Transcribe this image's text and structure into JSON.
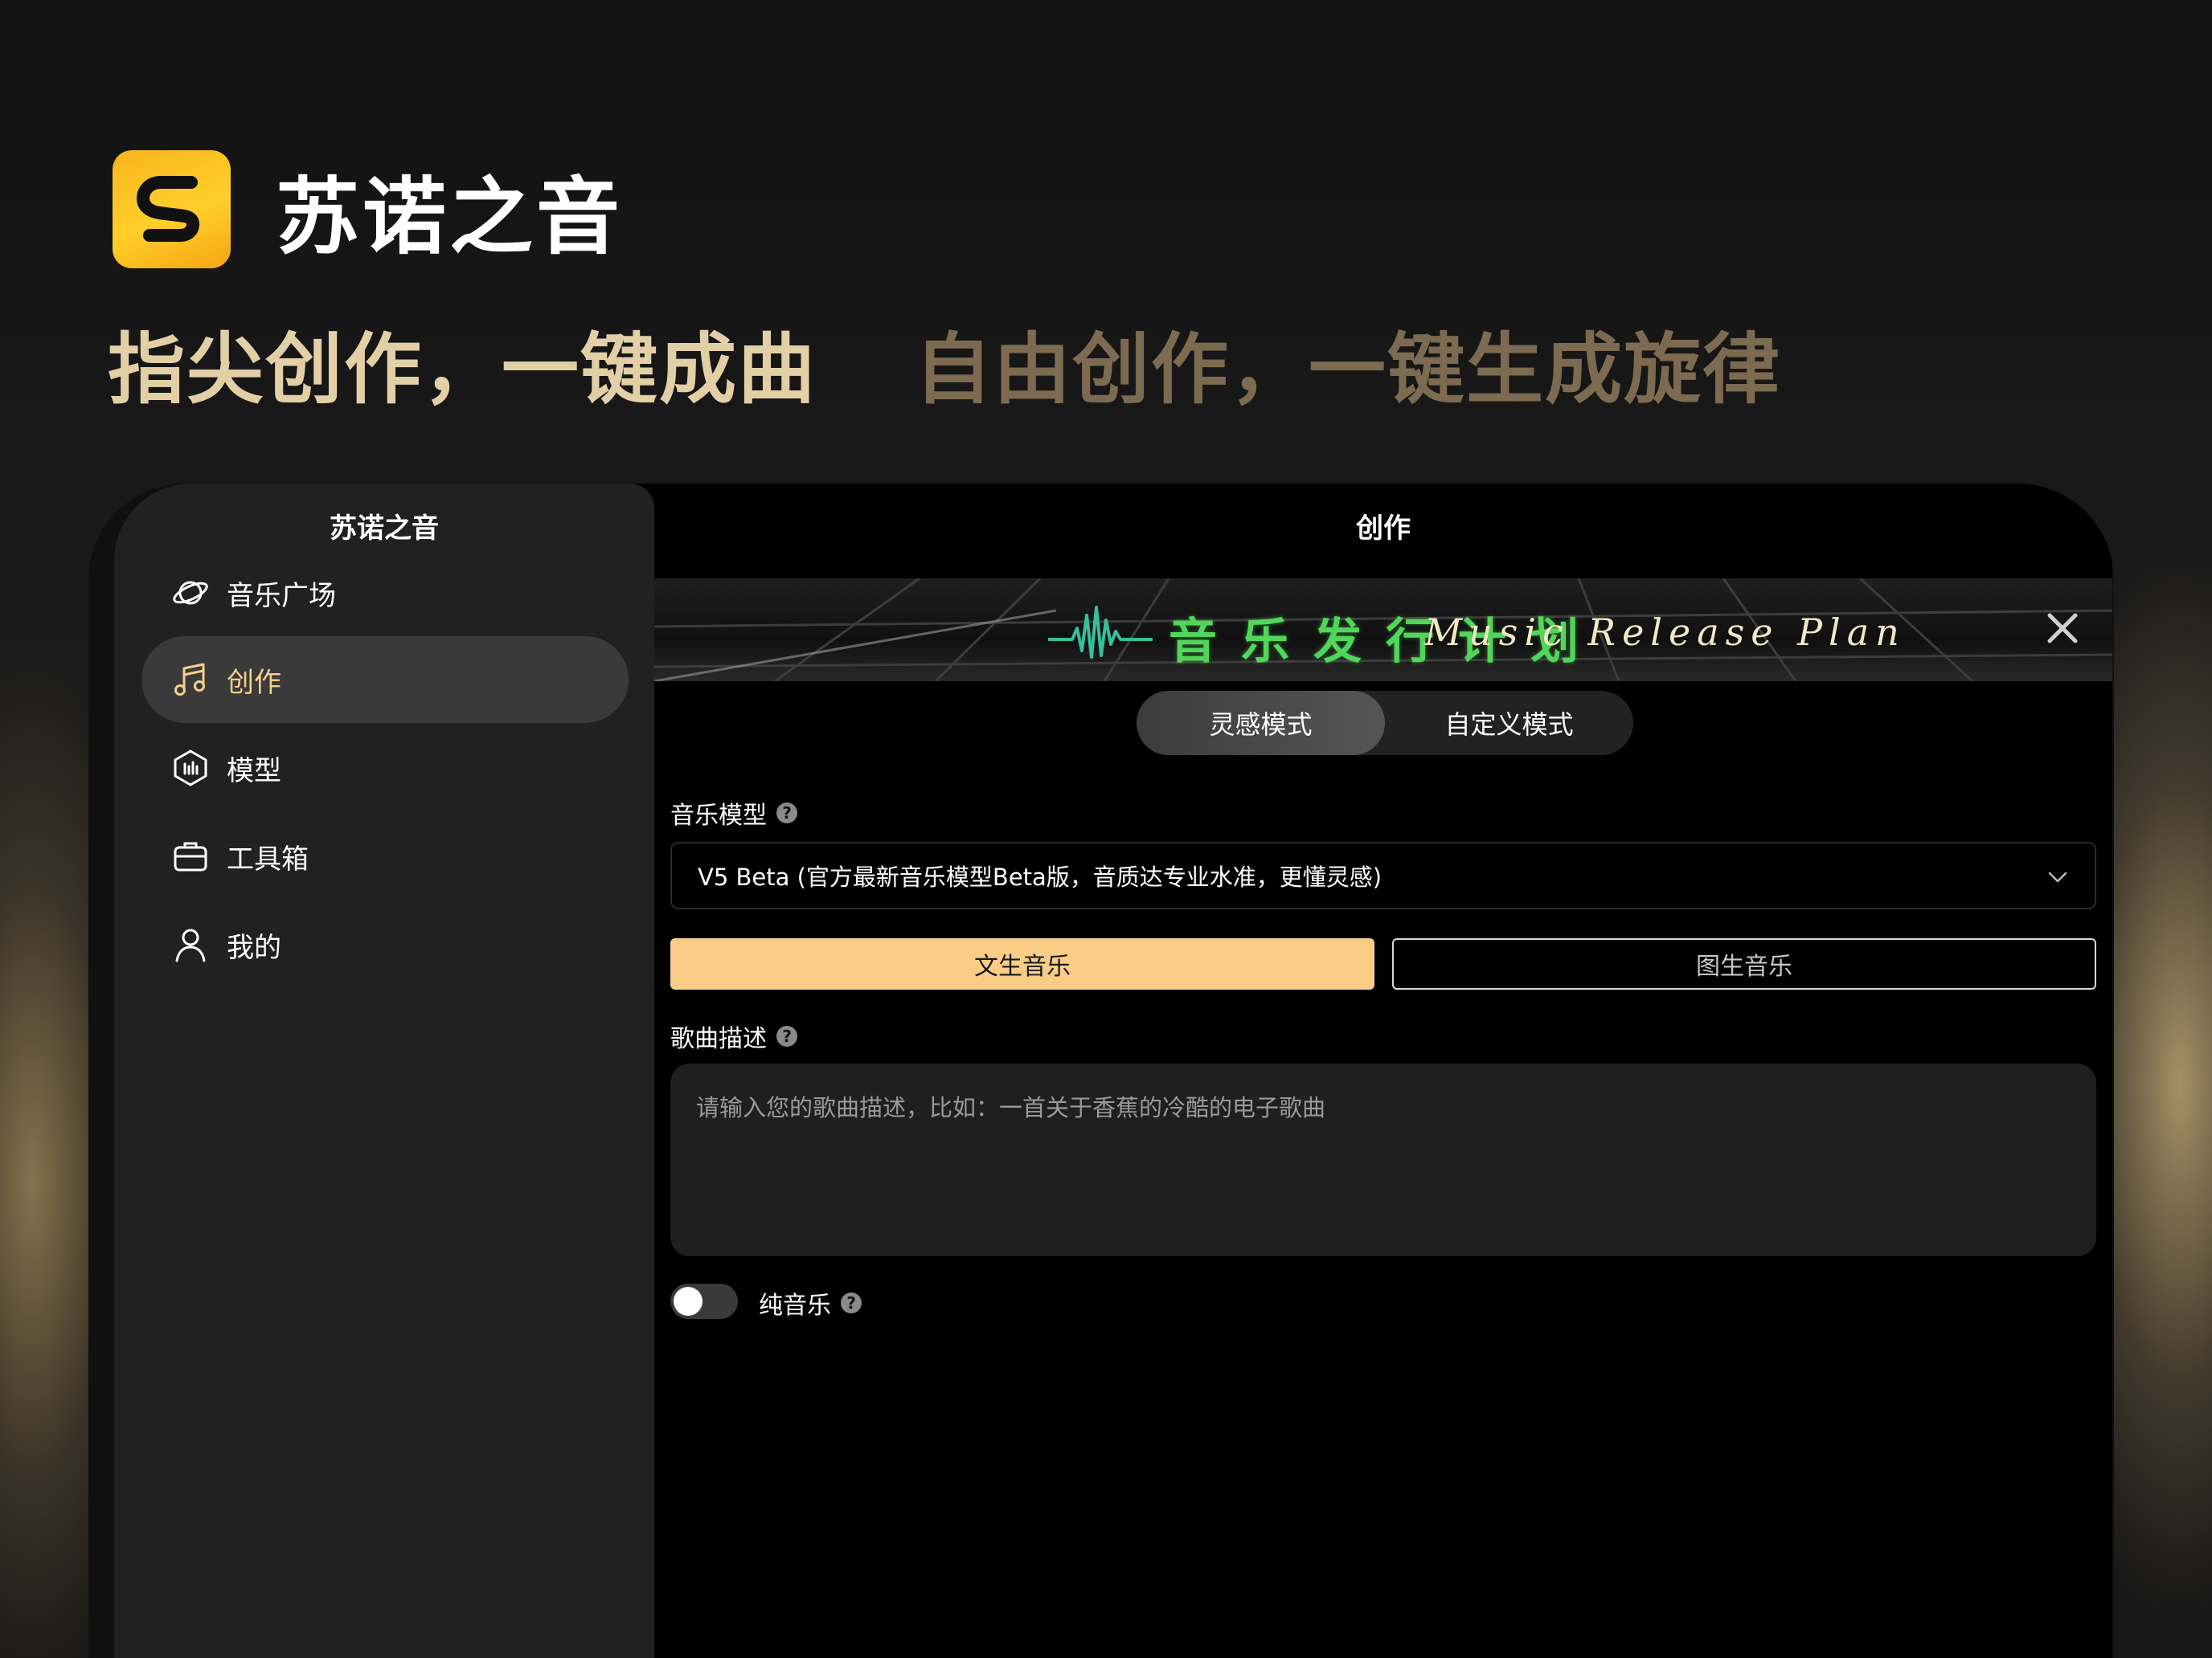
{
  "header": {
    "brand_name": "苏诺之音",
    "slogan_primary": "指尖创作，一键成曲",
    "slogan_secondary": "自由创作，一键生成旋律"
  },
  "sidebar": {
    "title": "苏诺之音",
    "items": [
      {
        "label": "音乐广场",
        "icon": "planet-icon",
        "active": false
      },
      {
        "label": "创作",
        "icon": "music-note-icon",
        "active": true
      },
      {
        "label": "模型",
        "icon": "model-hexagon-icon",
        "active": false
      },
      {
        "label": "工具箱",
        "icon": "toolbox-icon",
        "active": false
      },
      {
        "label": "我的",
        "icon": "user-icon",
        "active": false
      }
    ]
  },
  "main": {
    "title": "创作",
    "banner": {
      "title_cn": "音乐发行计划",
      "title_en": "Music Release Plan"
    },
    "mode_tabs": [
      {
        "label": "灵感模式",
        "active": true
      },
      {
        "label": "自定义模式",
        "active": false
      }
    ],
    "model_field": {
      "label": "音乐模型",
      "value": "V5 Beta (官方最新音乐模型Beta版，音质达专业水准，更懂灵感)"
    },
    "gen_types": [
      {
        "label": "文生音乐",
        "selected": true
      },
      {
        "label": "图生音乐",
        "selected": false
      }
    ],
    "description_field": {
      "label": "歌曲描述",
      "placeholder": "请输入您的歌曲描述，比如：一首关于香蕉的冷酷的电子歌曲"
    },
    "instrumental": {
      "label": "纯音乐",
      "enabled": false
    },
    "help_glyph": "?"
  },
  "colors": {
    "accent_gold": "#f9cd86",
    "logo_yellow": "#ffcf2b",
    "banner_green": "#52d65a"
  }
}
